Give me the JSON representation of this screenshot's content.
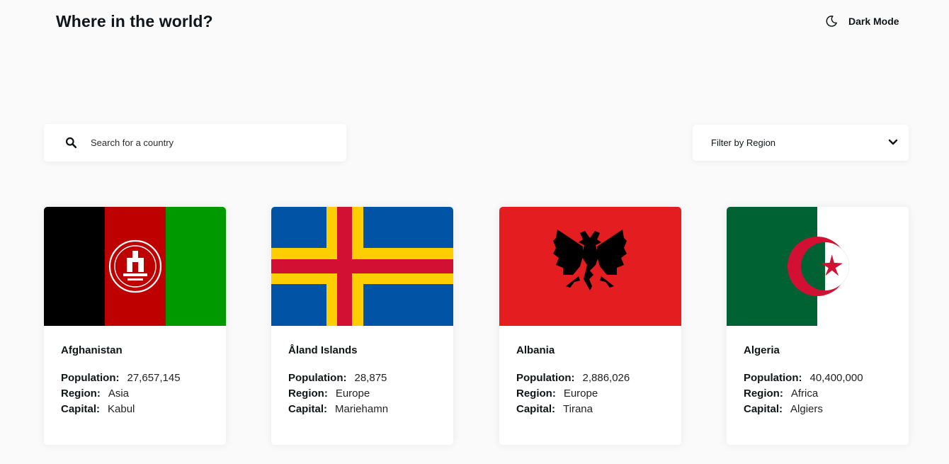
{
  "header": {
    "title": "Where in the world?",
    "dark_mode_label": "Dark Mode",
    "dark_mode_icon": "moon-icon"
  },
  "search": {
    "placeholder": "Search for a country",
    "value": "",
    "icon": "search-icon"
  },
  "filter": {
    "label": "Filter by Region",
    "icon": "chevron-down-icon"
  },
  "labels": {
    "population": "Population:",
    "region": "Region:",
    "capital": "Capital:"
  },
  "countries": [
    {
      "name": "Afghanistan",
      "population": "27,657,145",
      "region": "Asia",
      "capital": "Kabul",
      "flag_colors": [
        "#000000",
        "#be0000",
        "#009900"
      ]
    },
    {
      "name": "Åland Islands",
      "population": "28,875",
      "region": "Europe",
      "capital": "Mariehamn",
      "flag_colors": [
        "#0053a5",
        "#ffce00",
        "#d21034"
      ]
    },
    {
      "name": "Albania",
      "population": "2,886,026",
      "region": "Europe",
      "capital": "Tirana",
      "flag_colors": [
        "#e41e20",
        "#000000"
      ]
    },
    {
      "name": "Algeria",
      "population": "40,400,000",
      "region": "Africa",
      "capital": "Algiers",
      "flag_colors": [
        "#006233",
        "#ffffff",
        "#d21034"
      ]
    }
  ]
}
